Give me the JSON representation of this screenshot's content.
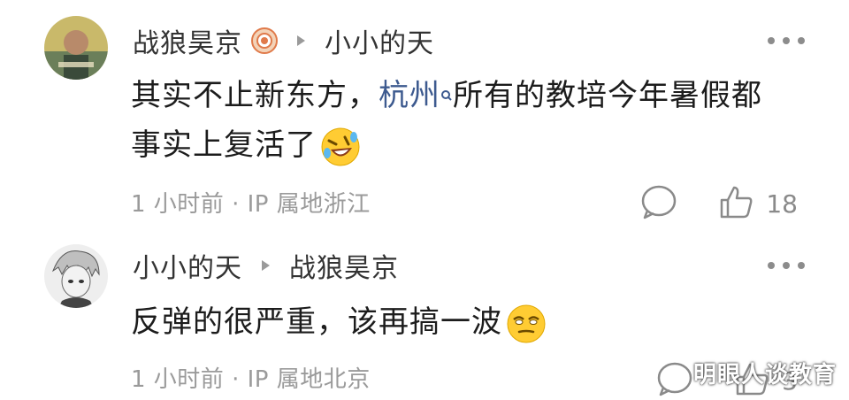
{
  "comments": [
    {
      "username": "战狼昊京",
      "reply_to": "小小的天",
      "content_before_link": "其实不止新东方，",
      "link_text": "杭州",
      "content_after_link": "所有的教培今年暑假都",
      "content_line2": "事实上复活了",
      "emoji": "rofl-emoji",
      "meta": "1 小时前 · IP 属地浙江",
      "likes": "18"
    },
    {
      "username": "小小的天",
      "reply_to": "战狼昊京",
      "content": "反弹的很严重，该再搞一波",
      "emoji": "smug-emoji",
      "meta": "1 小时前 · IP 属地北京",
      "likes": "3"
    }
  ],
  "watermark": "明眼人谈教育",
  "colors": {
    "link": "#3d5a8f",
    "meta": "#9a9a9a",
    "text": "#1c1c1c"
  }
}
